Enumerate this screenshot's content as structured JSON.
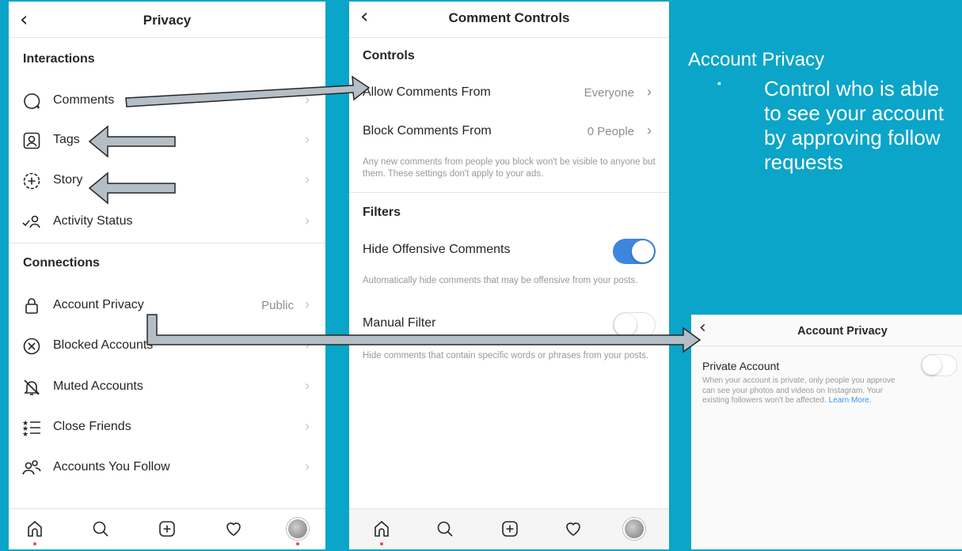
{
  "privacy_screen": {
    "title": "Privacy",
    "section_interactions": "Interactions",
    "section_connections": "Connections",
    "items": [
      {
        "label": "Comments",
        "value": ""
      },
      {
        "label": "Tags",
        "value": ""
      },
      {
        "label": "Story",
        "value": ""
      },
      {
        "label": "Activity Status",
        "value": ""
      },
      {
        "label": "Account Privacy",
        "value": "Public"
      },
      {
        "label": "Blocked Accounts",
        "value": ""
      },
      {
        "label": "Muted Accounts",
        "value": ""
      },
      {
        "label": "Close Friends",
        "value": ""
      },
      {
        "label": "Accounts You Follow",
        "value": ""
      }
    ]
  },
  "comment_controls_screen": {
    "title": "Comment Controls",
    "section_controls": "Controls",
    "allow_comments_label": "Allow Comments From",
    "allow_comments_value": "Everyone",
    "block_comments_label": "Block Comments From",
    "block_comments_value": "0 People",
    "block_help": "Any new comments from people you block won't be visible to anyone but them. These settings don't apply to your ads.",
    "section_filters": "Filters",
    "hide_offensive_label": "Hide Offensive Comments",
    "hide_offensive_on": true,
    "hide_offensive_help": "Automatically hide comments that may be offensive from your posts.",
    "manual_filter_label": "Manual Filter",
    "manual_filter_on": false,
    "manual_filter_help": "Hide comments that contain specific words or phrases from your posts."
  },
  "account_privacy_screen": {
    "title": "Account Privacy",
    "private_label": "Private Account",
    "private_on": false,
    "help_text": "When your account is private, only people you approve can see your photos and videos on Instagram. Your existing followers won't be affected.",
    "learn_more": "Learn More."
  },
  "annotation": {
    "title": "Account Privacy",
    "bullet": "▪",
    "text": "Control who is able to see your account by approving follow requests"
  },
  "tabbar_icons": [
    "home-icon",
    "search-icon",
    "add-post-icon",
    "heart-icon",
    "profile-avatar"
  ],
  "colors": {
    "background": "#0aa5c8",
    "toggle_on": "#3d86e0",
    "link": "#3897f0",
    "arrow_fill": "#b4bec6"
  }
}
